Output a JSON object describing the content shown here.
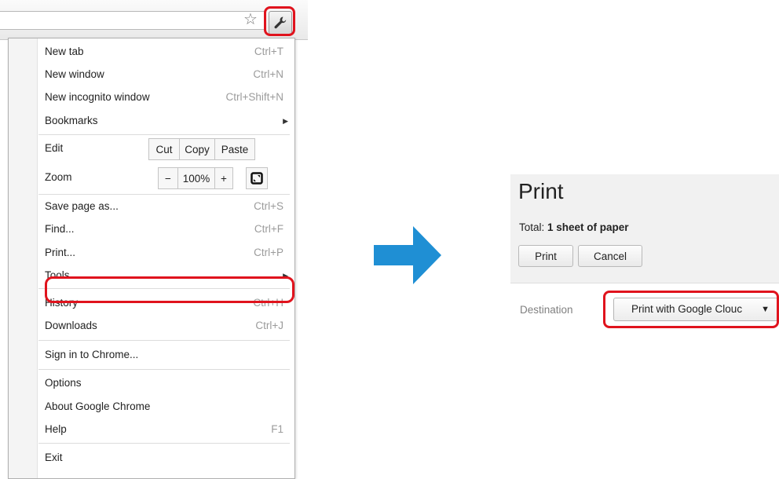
{
  "menu": {
    "items_top": [
      {
        "label": "New tab",
        "shortcut": "Ctrl+T"
      },
      {
        "label": "New window",
        "shortcut": "Ctrl+N"
      },
      {
        "label": "New incognito window",
        "shortcut": "Ctrl+Shift+N"
      },
      {
        "label": "Bookmarks",
        "shortcut": ""
      }
    ],
    "edit": {
      "label": "Edit",
      "cut": "Cut",
      "copy": "Copy",
      "paste": "Paste"
    },
    "zoom": {
      "label": "Zoom",
      "minus": "−",
      "value": "100%",
      "plus": "+"
    },
    "items_mid": [
      {
        "label": "Save page as...",
        "shortcut": "Ctrl+S"
      },
      {
        "label": "Find...",
        "shortcut": "Ctrl+F"
      },
      {
        "label": "Print...",
        "shortcut": "Ctrl+P"
      },
      {
        "label": "Tools",
        "shortcut": ""
      }
    ],
    "items_history": [
      {
        "label": "History",
        "shortcut": "Ctrl+H"
      },
      {
        "label": "Downloads",
        "shortcut": "Ctrl+J"
      }
    ],
    "sign_in": "Sign in to Chrome...",
    "items_bottom": [
      {
        "label": "Options",
        "shortcut": ""
      },
      {
        "label": "About Google Chrome",
        "shortcut": ""
      },
      {
        "label": "Help",
        "shortcut": "F1"
      }
    ],
    "exit": "Exit"
  },
  "print": {
    "title": "Print",
    "total_prefix": "Total: ",
    "total_value": "1 sheet of paper",
    "print_button": "Print",
    "cancel_button": "Cancel",
    "destination_label": "Destination",
    "destination_value": "Print with Google Clouc"
  },
  "colors": {
    "highlight": "#e0131d",
    "arrow": "#1f8fd4"
  }
}
